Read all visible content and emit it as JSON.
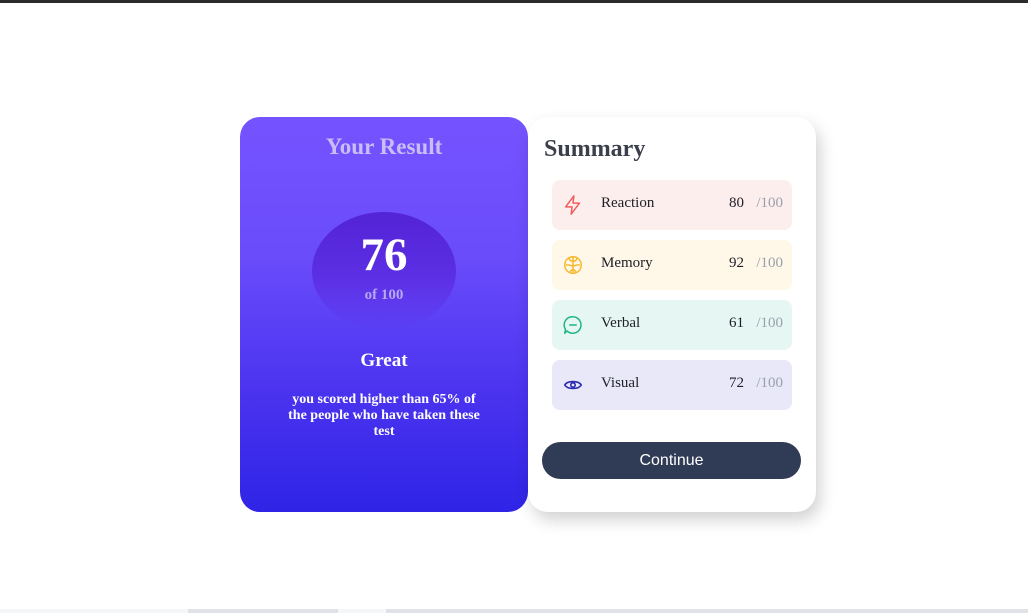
{
  "result": {
    "title": "Your Result",
    "score": "76",
    "score_max": "of 100",
    "rating": "Great",
    "description": "you scored higher than 65% of the people who have taken these test"
  },
  "summary": {
    "title": "Summary",
    "items": [
      {
        "label": "Reaction",
        "score": "80",
        "max": "/100",
        "icon": "lightning-icon",
        "color": "#f25c5c",
        "bg": "#fdeeee"
      },
      {
        "label": "Memory",
        "score": "92",
        "max": "/100",
        "icon": "brain-icon",
        "color": "#f5b82e",
        "bg": "#fff8e9"
      },
      {
        "label": "Verbal",
        "score": "61",
        "max": "/100",
        "icon": "chat-bubble-icon",
        "color": "#19b584",
        "bg": "#e6f7f3"
      },
      {
        "label": "Visual",
        "score": "72",
        "max": "/100",
        "icon": "eye-icon",
        "color": "#2d2db3",
        "bg": "#e8e8f8"
      }
    ],
    "continue_label": "Continue"
  },
  "colors": {
    "result_gradient_top": "#7553ff",
    "result_gradient_bottom": "#2f24e6",
    "button_bg": "#303b56"
  }
}
